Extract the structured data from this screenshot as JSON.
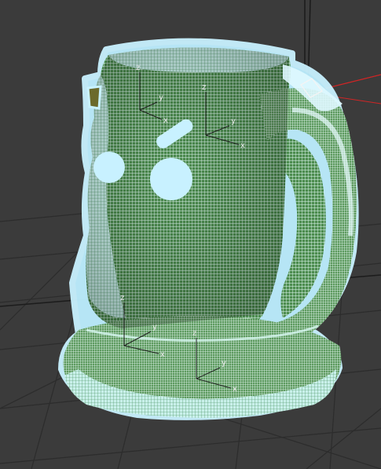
{
  "viewport": {
    "background": "#3b3b3b",
    "grid_color": "#2c2c2c",
    "grid_axis_color": "#1c1c1c",
    "world_axis_color": "#d02525"
  },
  "model": {
    "name": "mug",
    "state": "selected",
    "display": "wireframe",
    "selection_color": "#c9f2ff",
    "wire_color": "#2f7a3a",
    "fill_color": "#4d8d50",
    "highlight_color": "#e8fbff"
  },
  "gizmos": [
    {
      "id": "gizmo-upper-left",
      "axes": [
        "z",
        "y",
        "x"
      ]
    },
    {
      "id": "gizmo-upper-mid",
      "axes": [
        "z",
        "y",
        "x"
      ]
    },
    {
      "id": "gizmo-lower-left",
      "axes": [
        "z",
        "y",
        "x"
      ]
    },
    {
      "id": "gizmo-lower-mid",
      "axes": [
        "z",
        "y",
        "x"
      ]
    }
  ],
  "icons": [
    "world-axis-icon",
    "selection-marker-icon"
  ]
}
